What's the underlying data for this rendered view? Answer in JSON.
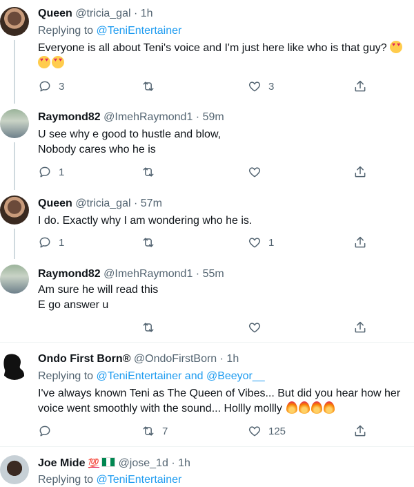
{
  "tweets": [
    {
      "name": "Queen",
      "handle": "@tricia_gal",
      "dot": "·",
      "time": "1h",
      "replying_prefix": "Replying to ",
      "replying_to": "@TeniEntertainer",
      "text_line1": "Everyone is all about Teni's voice and I'm just here like who is that guy?",
      "replies": "3",
      "retweets": "",
      "likes": "3"
    },
    {
      "name": "Raymond82",
      "handle": "@ImehRaymond1",
      "dot": "·",
      "time": "59m",
      "text_line1": "U see why e good to hustle and blow,",
      "text_line2": "Nobody cares who he is",
      "replies": "1",
      "retweets": "",
      "likes": ""
    },
    {
      "name": "Queen",
      "handle": "@tricia_gal",
      "dot": "·",
      "time": "57m",
      "text_line1": "I do. Exactly why I am wondering who he is.",
      "replies": "1",
      "retweets": "",
      "likes": "1"
    },
    {
      "name": "Raymond82",
      "handle": "@ImehRaymond1",
      "dot": "·",
      "time": "55m",
      "text_line1": "Am sure he will read this",
      "text_line2": "E go answer u",
      "replies": "",
      "retweets": "",
      "likes": ""
    },
    {
      "name": "Ondo First Born®",
      "handle": "@OndoFirstBorn",
      "dot": "·",
      "time": "1h",
      "replying_prefix": "Replying to ",
      "replying_to": "@TeniEntertainer and @Beeyor__",
      "text_line1": "I've always known Teni as The Queen of Vibes... But did you hear how her",
      "text_line2": "voice went smoothly with the sound... Hollly mollly",
      "replies": "",
      "retweets": "7",
      "likes": "125"
    },
    {
      "name": "Joe Mide",
      "badge": "💯",
      "handle": "@jose_1d",
      "dot": "·",
      "time": "1h",
      "replying_prefix": "Replying to ",
      "replying_to": "@TeniEntertainer"
    }
  ],
  "icons": {
    "reply": "reply-icon",
    "retweet": "retweet-icon",
    "like": "like-icon",
    "share": "share-icon"
  },
  "colors": {
    "link": "#1d9bf0",
    "secondary_text": "#536471",
    "divider": "#eff3f4"
  }
}
